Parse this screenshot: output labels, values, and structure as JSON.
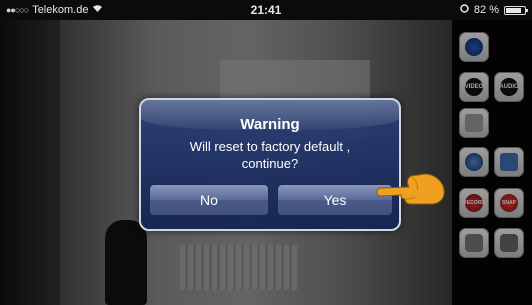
{
  "status_bar": {
    "carrier": "Telekom.de",
    "time": "21:41",
    "battery": "82 %",
    "battery_level": 0.82
  },
  "dialog": {
    "title": "Warning",
    "message_line1": "Will reset to factory default ,",
    "message_line2": "continue?",
    "no_label": "No",
    "yes_label": "Yes"
  },
  "toolbar": {
    "video_label": "VIDEO",
    "audio_label": "AUDIO",
    "record_label": "RECORD",
    "snapshot_label": "SNAP"
  },
  "colors": {
    "dialog_bg": "#23396f",
    "dialog_border": "#cfd6e6",
    "hand": "#f0a020"
  }
}
